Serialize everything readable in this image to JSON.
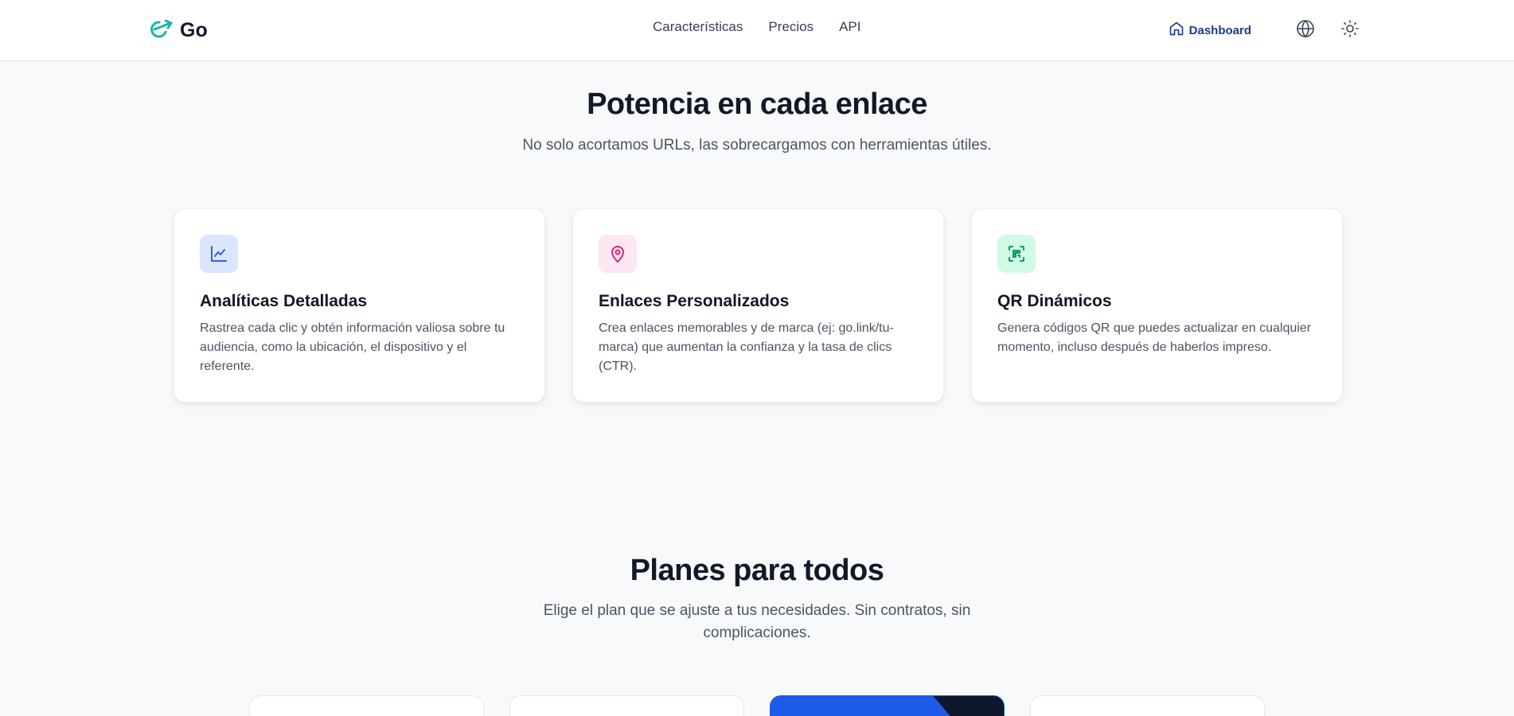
{
  "header": {
    "logo_text": "Go",
    "nav": [
      "Características",
      "Precios",
      "API"
    ],
    "dashboard_label": "Dashboard"
  },
  "features": {
    "title": "Potencia en cada enlace",
    "subtitle": "No solo acortamos URLs, las sobrecargamos con herramientas útiles.",
    "cards": [
      {
        "icon": "line-chart-icon",
        "title": "Analíticas Detalladas",
        "text": "Rastrea cada clic y obtén información valiosa sobre tu audiencia, como la ubicación, el dispositivo y el referente.",
        "icon_bg": "#dbe6fe",
        "icon_color": "#2563eb"
      },
      {
        "icon": "map-pin-icon",
        "title": "Enlaces Personalizados",
        "text": "Crea enlaces memorables y de marca (ej: go.link/tu-marca) que aumentan la confianza y la tasa de clics (CTR).",
        "icon_bg": "#fce7f3",
        "icon_color": "#db2777"
      },
      {
        "icon": "qr-scan-icon",
        "title": "QR Dinámicos",
        "text": "Genera códigos QR que puedes actualizar en cualquier momento, incluso después de haberlos impreso.",
        "icon_bg": "#d1fae5",
        "icon_color": "#059669"
      }
    ]
  },
  "plans": {
    "title": "Planes para todos",
    "subtitle": "Elige el plan que se ajuste a tus necesidades. Sin contratos, sin complicaciones."
  },
  "colors": {
    "accent": "#1d5ae6",
    "logo_teal": "#14b8a6"
  }
}
